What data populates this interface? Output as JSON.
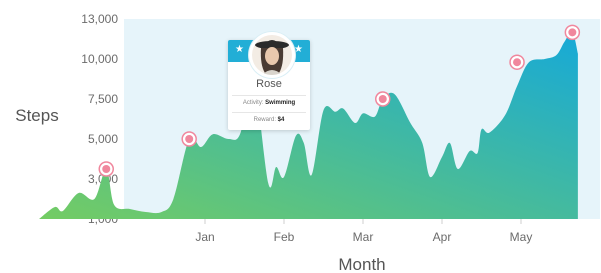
{
  "chart_data": {
    "type": "area",
    "xlabel": "Month",
    "ylabel": "Steps",
    "yticks": [
      "1,000",
      "3,000",
      "5,000",
      "7,500",
      "10,000",
      "13,000"
    ],
    "ytick_values": [
      1000,
      3000,
      5000,
      7500,
      10000,
      13000
    ],
    "ylim": [
      1000,
      13000
    ],
    "xticks": [
      "Jan",
      "Feb",
      "Mar",
      "Apr",
      "May"
    ],
    "grid": false,
    "series": [
      {
        "points": [
          [
            -2.1,
            1000
          ],
          [
            -1.9,
            1600
          ],
          [
            -1.8,
            1400
          ],
          [
            -1.6,
            2300
          ],
          [
            -1.4,
            2000
          ],
          [
            -1.25,
            3500
          ],
          [
            -1.15,
            1700
          ],
          [
            -0.95,
            1500
          ],
          [
            -0.75,
            1350
          ],
          [
            -0.55,
            1350
          ],
          [
            -0.4,
            2000
          ],
          [
            -0.2,
            5000
          ],
          [
            -0.05,
            4600
          ],
          [
            0.1,
            5300
          ],
          [
            0.3,
            5000
          ],
          [
            0.45,
            5400
          ],
          [
            0.6,
            9200
          ],
          [
            0.8,
            2800
          ],
          [
            0.9,
            3600
          ],
          [
            1.0,
            3100
          ],
          [
            1.15,
            5200
          ],
          [
            1.25,
            4800
          ],
          [
            1.35,
            3200
          ],
          [
            1.5,
            6800
          ],
          [
            1.65,
            6700
          ],
          [
            1.75,
            6900
          ],
          [
            1.9,
            6000
          ],
          [
            2.0,
            6600
          ],
          [
            2.15,
            6400
          ],
          [
            2.25,
            7500
          ],
          [
            2.4,
            7800
          ],
          [
            2.6,
            6000
          ],
          [
            2.75,
            4800
          ],
          [
            2.85,
            3100
          ],
          [
            3.0,
            4100
          ],
          [
            3.1,
            4800
          ],
          [
            3.2,
            3500
          ],
          [
            3.35,
            4400
          ],
          [
            3.45,
            4300
          ],
          [
            3.5,
            5600
          ],
          [
            3.6,
            5400
          ],
          [
            3.8,
            6500
          ],
          [
            3.95,
            8300
          ],
          [
            4.1,
            9800
          ],
          [
            4.3,
            10000
          ],
          [
            4.45,
            10300
          ],
          [
            4.55,
            11300
          ],
          [
            4.65,
            12000
          ],
          [
            4.72,
            10400
          ]
        ]
      }
    ],
    "markers": [
      [
        -1.25,
        3500
      ],
      [
        -0.2,
        5000
      ],
      [
        2.25,
        7500
      ],
      [
        3.95,
        9800
      ],
      [
        4.65,
        12000
      ]
    ],
    "colors": {
      "area_top": "#16a9d8",
      "area_bottom": "#74cc63",
      "plot_bg": "#e6f4fa",
      "marker": "#f0879d"
    }
  },
  "tooltip": {
    "name": "Rose",
    "activity_label": "Activity:",
    "activity_value": "Swimming",
    "reward_label": "Reward:",
    "reward_value": "$4"
  }
}
